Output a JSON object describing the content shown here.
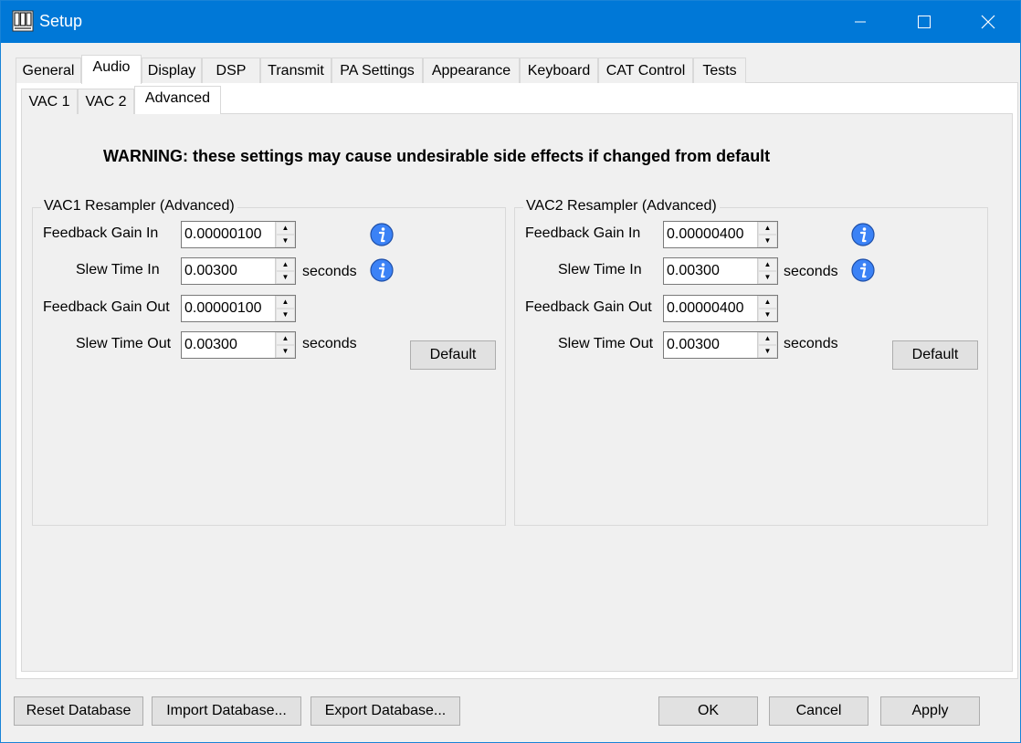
{
  "window": {
    "title": "Setup"
  },
  "tabs": [
    "General",
    "Audio",
    "Display",
    "DSP",
    "Transmit",
    "PA Settings",
    "Appearance",
    "Keyboard",
    "CAT Control",
    "Tests"
  ],
  "subtabs": [
    "VAC 1",
    "VAC 2",
    "Advanced"
  ],
  "warning": "WARNING: these settings may cause undesirable side effects if changed from default",
  "vac1": {
    "title": "VAC1 Resampler (Advanced)",
    "feedback_gain_in_label": "Feedback Gain In",
    "feedback_gain_in": "0.00000100",
    "slew_time_in_label": "Slew Time In",
    "slew_time_in": "0.00300",
    "feedback_gain_out_label": "Feedback Gain Out",
    "feedback_gain_out": "0.00000100",
    "slew_time_out_label": "Slew Time Out",
    "slew_time_out": "0.00300",
    "seconds_label": "seconds",
    "default_button": "Default"
  },
  "vac2": {
    "title": "VAC2 Resampler (Advanced)",
    "feedback_gain_in_label": "Feedback Gain In",
    "feedback_gain_in": "0.00000400",
    "slew_time_in_label": "Slew Time In",
    "slew_time_in": "0.00300",
    "feedback_gain_out_label": "Feedback Gain Out",
    "feedback_gain_out": "0.00000400",
    "slew_time_out_label": "Slew Time Out",
    "slew_time_out": "0.00300",
    "seconds_label": "seconds",
    "default_button": "Default"
  },
  "footer": {
    "reset_database": "Reset Database",
    "import_database": "Import Database...",
    "export_database": "Export Database...",
    "ok": "OK",
    "cancel": "Cancel",
    "apply": "Apply"
  },
  "colors": {
    "titlebar": "#0078d7",
    "info_icon": "#3b82f6"
  }
}
